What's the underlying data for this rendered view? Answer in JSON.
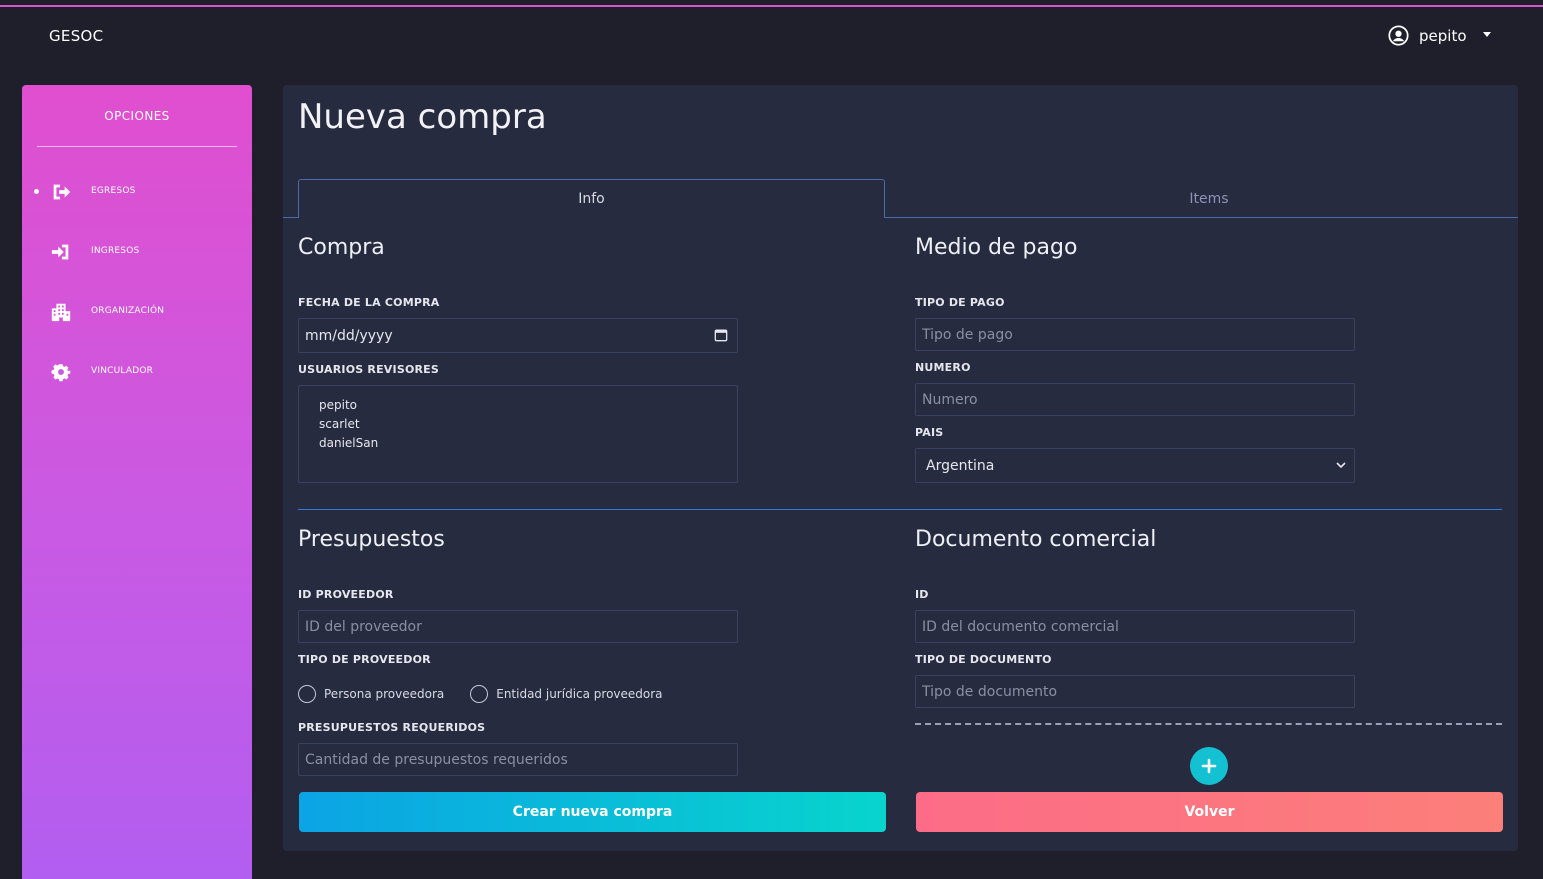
{
  "app": {
    "brand": "GESOC"
  },
  "user": {
    "name": "pepito"
  },
  "sidebar": {
    "title": "OPCIONES",
    "items": [
      {
        "label": "EGRESOS",
        "icon": "sign-out-icon",
        "active": true
      },
      {
        "label": "INGRESOS",
        "icon": "sign-in-icon",
        "active": false
      },
      {
        "label": "ORGANIZACIÓN",
        "icon": "building-icon",
        "active": false
      },
      {
        "label": "VINCULADOR",
        "icon": "gear-icon",
        "active": false
      }
    ]
  },
  "page": {
    "title": "Nueva compra",
    "tabs": [
      {
        "label": "Info",
        "active": true
      },
      {
        "label": "Items",
        "active": false
      }
    ]
  },
  "compra": {
    "heading": "Compra",
    "fecha_label": "FECHA DE LA COMPRA",
    "fecha_value": "mm/dd/yyyy",
    "usuarios_label": "USUARIOS REVISORES",
    "usuarios": [
      "pepito",
      "scarlet",
      "danielSan"
    ]
  },
  "medio_pago": {
    "heading": "Medio de pago",
    "tipo_label": "TIPO DE PAGO",
    "tipo_placeholder": "Tipo de pago",
    "numero_label": "NUMERO",
    "numero_placeholder": "Numero",
    "pais_label": "PAIS",
    "pais_value": "Argentina"
  },
  "presupuestos": {
    "heading": "Presupuestos",
    "id_label": "ID PROVEEDOR",
    "id_placeholder": "ID del proveedor",
    "tipo_label": "TIPO DE PROVEEDOR",
    "radio_1": "Persona proveedora",
    "radio_2": "Entidad jurídica proveedora",
    "requeridos_label": "PRESUPUESTOS REQUERIDOS",
    "requeridos_placeholder": "Cantidad de presupuestos requeridos"
  },
  "documento": {
    "heading": "Documento comercial",
    "id_label": "ID",
    "id_placeholder": "ID del documento comercial",
    "tipo_label": "TIPO DE DOCUMENTO",
    "tipo_placeholder": "Tipo de documento"
  },
  "actions": {
    "create_label": "Crear nueva compra",
    "back_label": "Volver"
  },
  "colors": {
    "accent_pink": "#e04fcf",
    "accent_cyan": "#08d4cd",
    "accent_coral": "#fc6c87",
    "panel": "#272b3f"
  }
}
